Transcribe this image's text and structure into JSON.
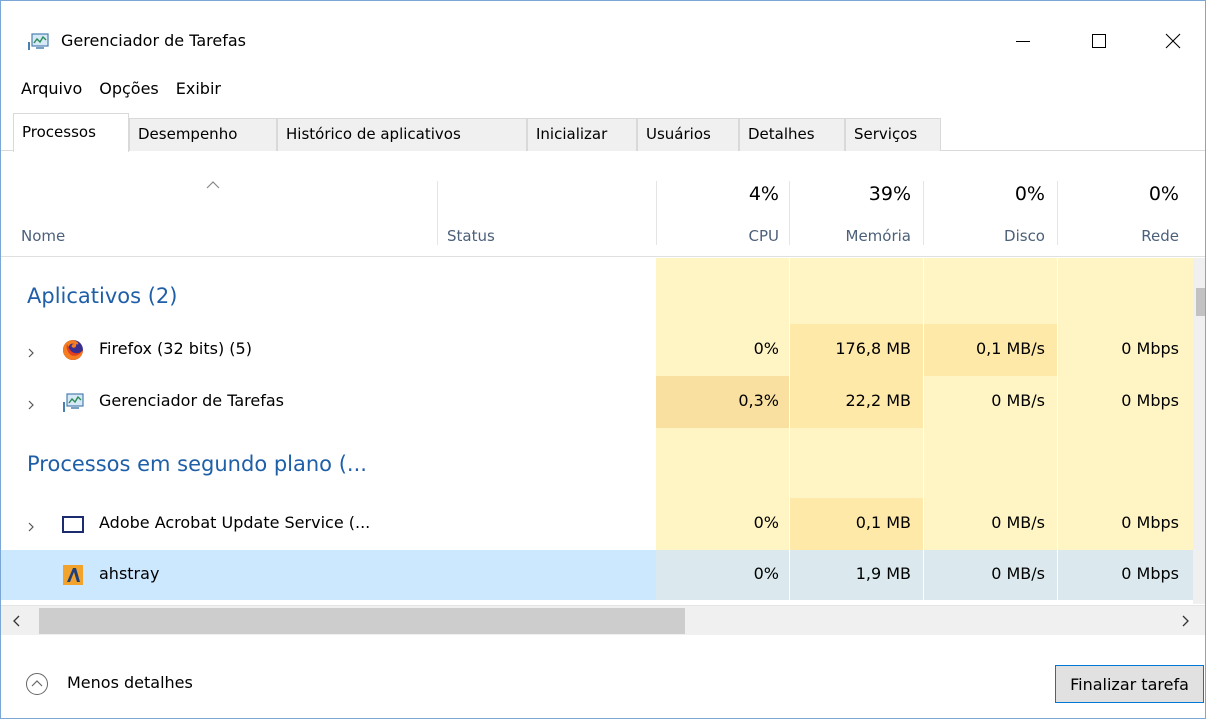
{
  "window": {
    "title": "Gerenciador de Tarefas"
  },
  "menu": [
    "Arquivo",
    "Opções",
    "Exibir"
  ],
  "tabs": [
    "Processos",
    "Desempenho",
    "Histórico de aplicativos",
    "Inicializar",
    "Usuários",
    "Detalhes",
    "Serviços"
  ],
  "active_tab": "Processos",
  "columns": {
    "name": "Nome",
    "status": "Status",
    "cpu": {
      "pct": "4%",
      "label": "CPU"
    },
    "memory": {
      "pct": "39%",
      "label": "Memória"
    },
    "disk": {
      "pct": "0%",
      "label": "Disco"
    },
    "network": {
      "pct": "0%",
      "label": "Rede"
    }
  },
  "groups": {
    "apps": "Aplicativos (2)",
    "background": "Processos em segundo plano (..."
  },
  "rows": [
    {
      "name": "Firefox (32 bits) (5)",
      "cpu": "0%",
      "mem": "176,8 MB",
      "disk": "0,1 MB/s",
      "net": "0 Mbps"
    },
    {
      "name": "Gerenciador de Tarefas",
      "cpu": "0,3%",
      "mem": "22,2 MB",
      "disk": "0 MB/s",
      "net": "0 Mbps"
    },
    {
      "name": "Adobe Acrobat Update Service (...",
      "cpu": "0%",
      "mem": "0,1 MB",
      "disk": "0 MB/s",
      "net": "0 Mbps"
    },
    {
      "name": "ahstray",
      "cpu": "0%",
      "mem": "1,9 MB",
      "disk": "0 MB/s",
      "net": "0 Mbps"
    }
  ],
  "footer": {
    "less_details": "Menos detalhes",
    "end_task": "Finalizar tarefa"
  },
  "colors": {
    "heat_light": "#fff4c4",
    "heat_medium": "#ffe9a8",
    "heat_strong": "#f9e0a0",
    "selected": "#cce8ff",
    "group_title": "#1f5fa8"
  }
}
